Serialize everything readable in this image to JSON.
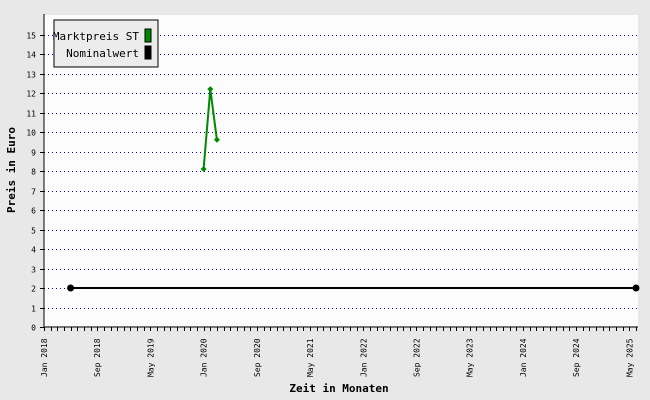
{
  "chart_data": {
    "type": "line",
    "xlabel": "Zeit in Monaten",
    "ylabel": "Preis in Euro",
    "ylim": [
      0,
      16
    ],
    "y_ticks": [
      0,
      1,
      2,
      3,
      4,
      5,
      6,
      7,
      8,
      9,
      10,
      11,
      12,
      13,
      14,
      15
    ],
    "x_ticks": [
      {
        "label": "Jan 2018",
        "date": "2018-01"
      },
      {
        "label": "Sep 2018",
        "date": "2018-09"
      },
      {
        "label": "May 2019",
        "date": "2019-05"
      },
      {
        "label": "Jan 2020",
        "date": "2020-01"
      },
      {
        "label": "Sep 2020",
        "date": "2020-09"
      },
      {
        "label": "May 2021",
        "date": "2021-05"
      },
      {
        "label": "Jan 2022",
        "date": "2022-01"
      },
      {
        "label": "Sep 2022",
        "date": "2022-09"
      },
      {
        "label": "May 2023",
        "date": "2023-05"
      },
      {
        "label": "Jan 2024",
        "date": "2024-01"
      },
      {
        "label": "Sep 2024",
        "date": "2024-09"
      },
      {
        "label": "May 2025",
        "date": "2025-05"
      }
    ],
    "xlim": [
      "2018-01",
      "2025-06"
    ],
    "grid": true,
    "legend_position": "top-left",
    "series": [
      {
        "name": "Marktpreis ST",
        "color": "#008800",
        "points": [
          {
            "x": "2020-01",
            "y": 8.1
          },
          {
            "x": "2020-02",
            "y": 12.2
          },
          {
            "x": "2020-03",
            "y": 9.6
          }
        ]
      },
      {
        "name": "Nominalwert",
        "color": "#000000",
        "points": [
          {
            "x": "2018-05",
            "y": 2
          },
          {
            "x": "2025-06",
            "y": 2
          }
        ]
      }
    ]
  }
}
